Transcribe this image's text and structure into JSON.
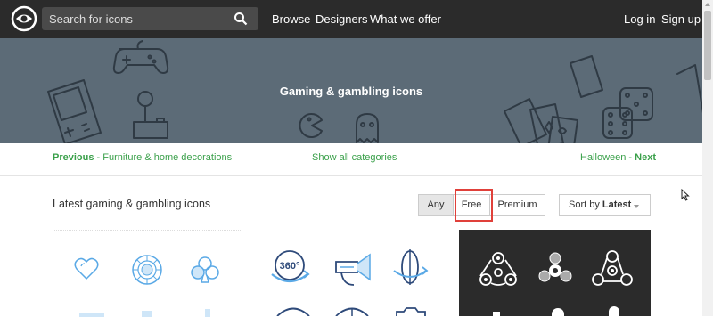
{
  "header": {
    "search_placeholder": "Search for icons",
    "nav": [
      "Browse",
      "Designers",
      "What we offer"
    ],
    "login": "Log in",
    "signup": "Sign up"
  },
  "banner": {
    "title": "Gaming & gambling icons"
  },
  "category_nav": {
    "previous_label": "Previous",
    "previous_sep": " - ",
    "previous_category": "Furniture & home decorations",
    "show_all": "Show all categories",
    "next_category": "Halloween",
    "next_sep": " - ",
    "next_label": "Next"
  },
  "section": {
    "title": "Latest gaming & gambling icons",
    "filters": [
      "Any",
      "Free",
      "Premium"
    ],
    "active_filter": "Any",
    "sort_prefix": "Sort by ",
    "sort_value": "Latest"
  },
  "colors": {
    "topbar": "#2b2b2b",
    "banner": "#5c6b77",
    "link_green": "#3aa04a",
    "highlight_red": "#e0403a",
    "icon_blue": "#5aa9e6",
    "icon_navy": "#2e4a7a"
  },
  "icons": {
    "logo": "iconfinder-eye-logo",
    "search": "magnifier-icon",
    "card1": [
      "heart-icon",
      "poker-chip-icon",
      "club-icon"
    ],
    "card2": [
      "360-degree-icon",
      "vr-headset-icon",
      "rotate-sphere-icon"
    ],
    "card3": [
      "fidget-spinner-icon",
      "fidget-spinner-icon",
      "fidget-spinner-icon"
    ]
  }
}
